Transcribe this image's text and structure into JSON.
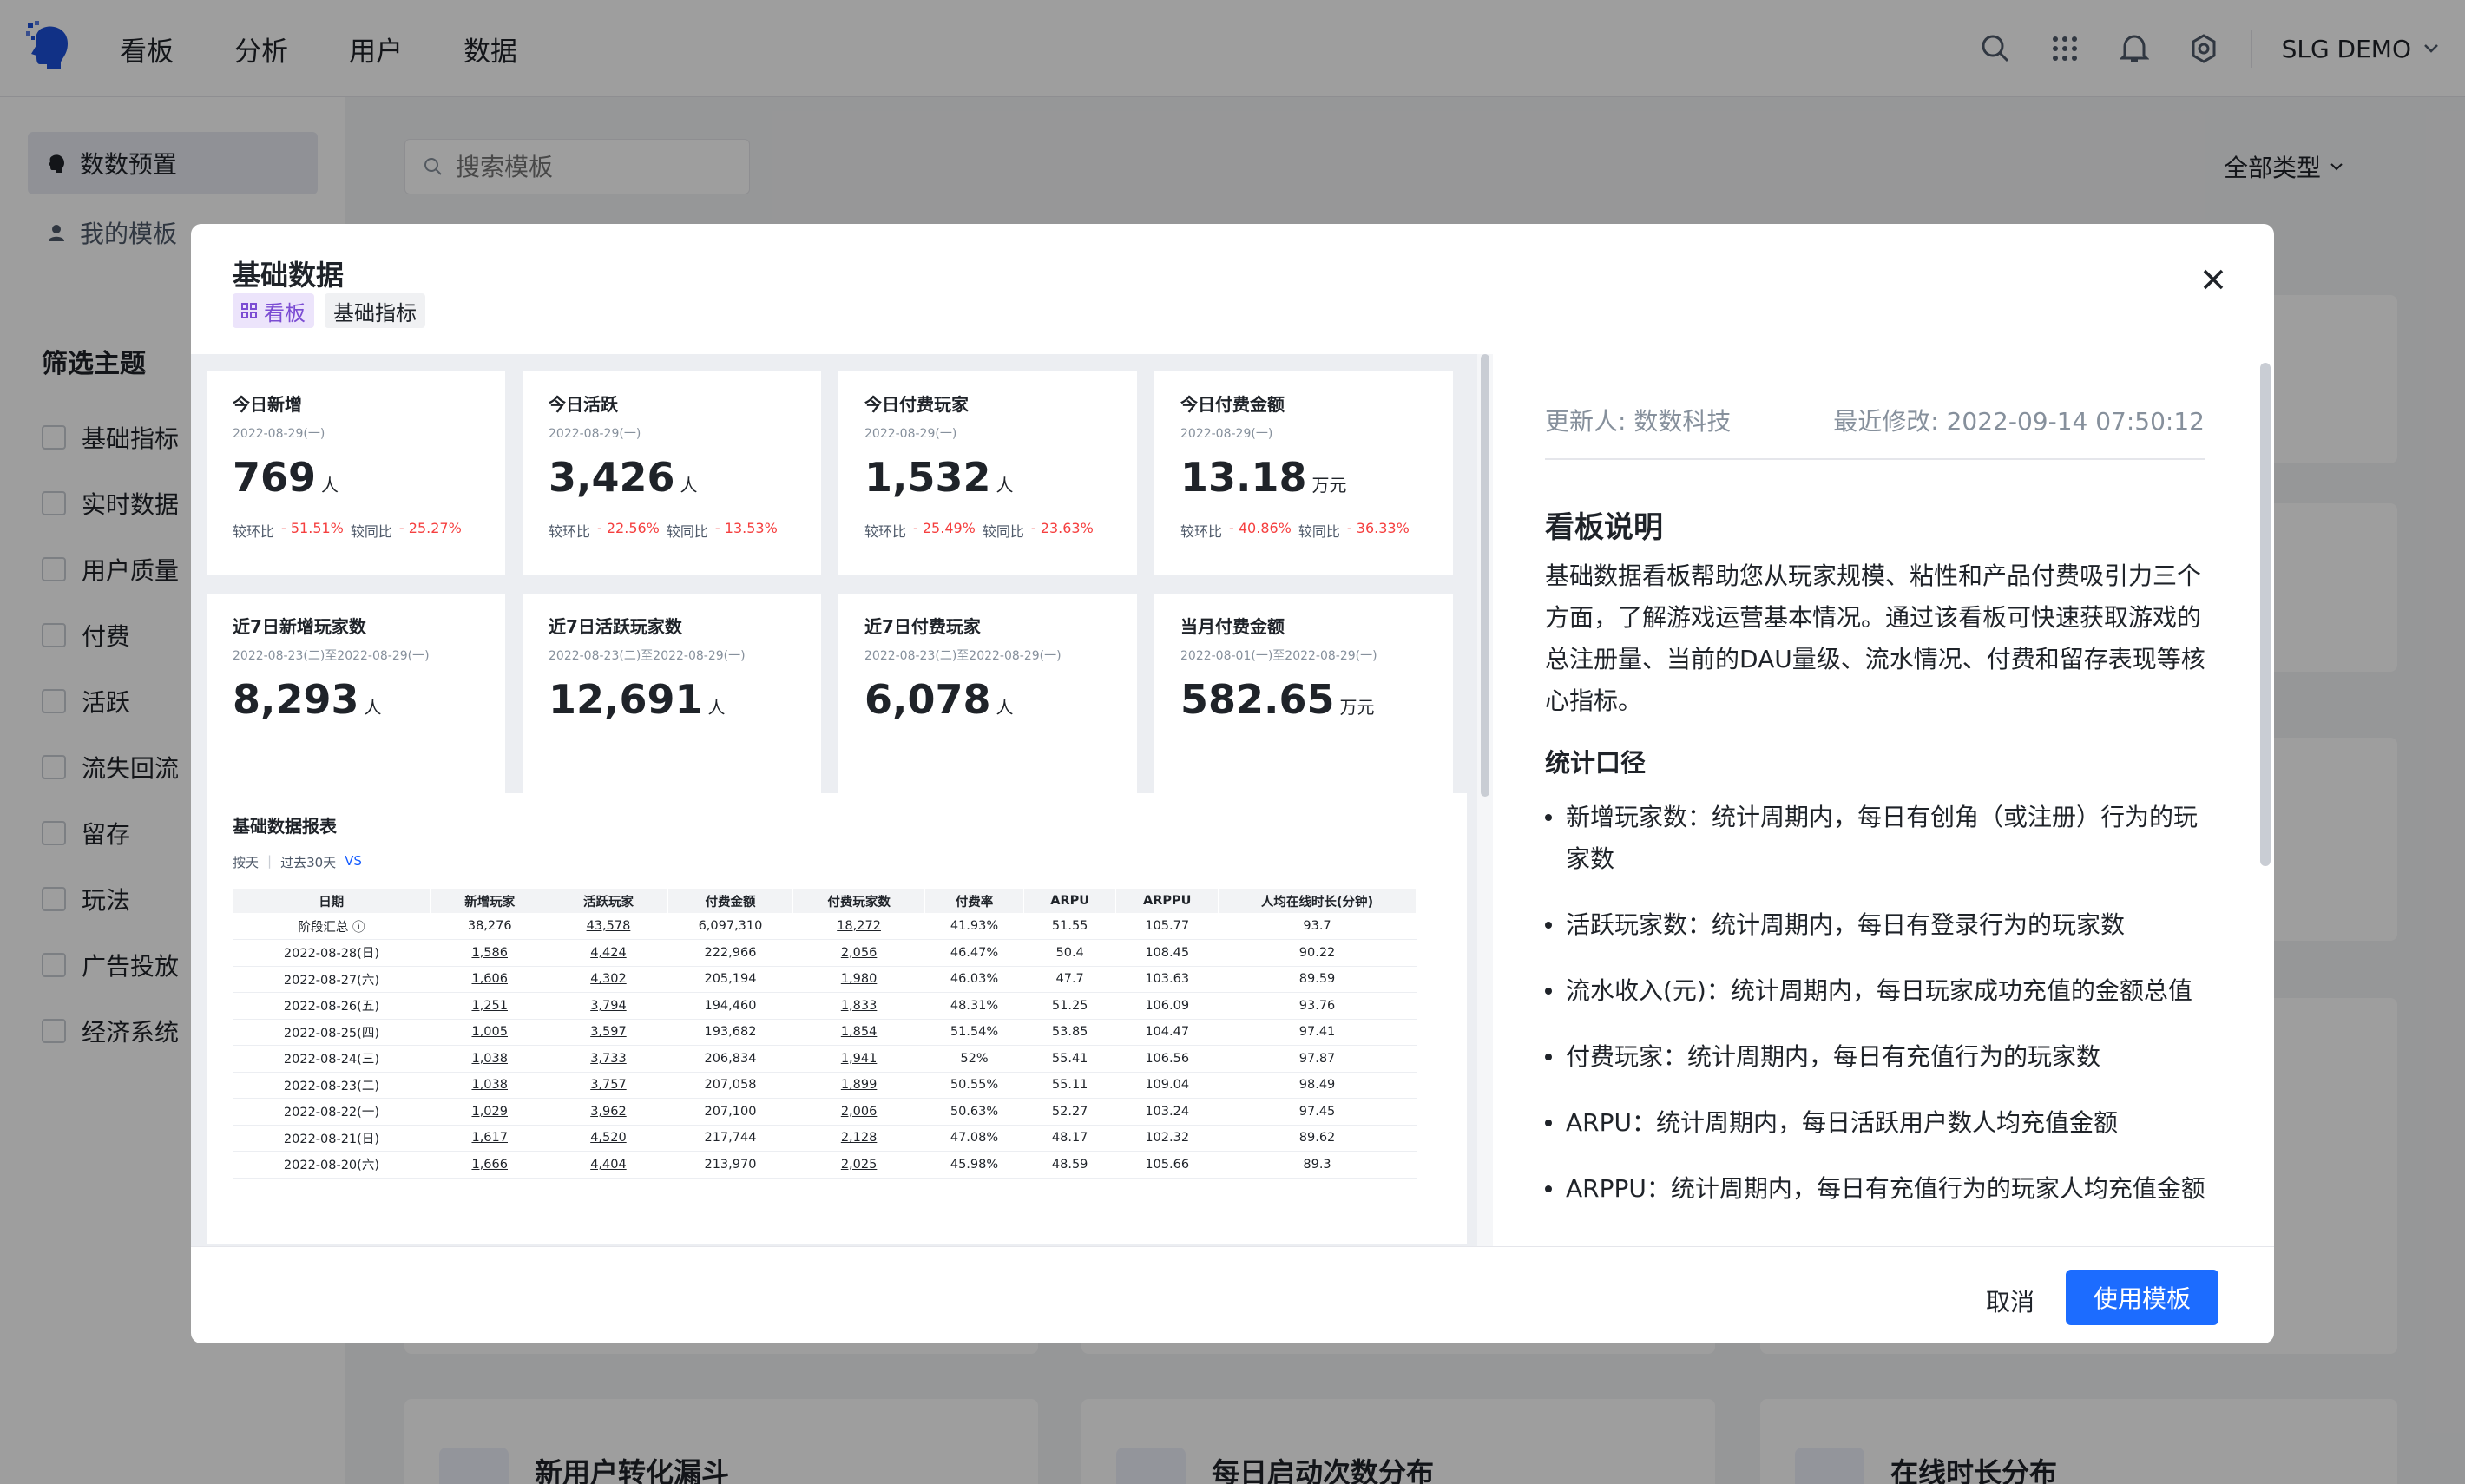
{
  "nav": {
    "items": [
      "看板",
      "分析",
      "用户",
      "数据"
    ],
    "project": "SLG DEMO"
  },
  "sidebar": {
    "items": [
      {
        "label": "数数预置"
      },
      {
        "label": "我的模板"
      }
    ],
    "filter_title": "筛选主题",
    "filters": [
      "基础指标",
      "实时数据",
      "用户质量",
      "付费",
      "活跃",
      "流失回流",
      "留存",
      "玩法",
      "广告投放",
      "经济系统"
    ]
  },
  "search": {
    "placeholder": "搜索模板"
  },
  "type_filter": "全部类型",
  "bg_cards": [
    "新用户转化漏斗",
    "每日启动次数分布",
    "在线时长分布"
  ],
  "modal": {
    "title": "基础数据",
    "tags": [
      "看板",
      "基础指标"
    ],
    "kpis": [
      {
        "label": "今日新增",
        "date": "2022-08-29(一)",
        "value": "769",
        "unit": "人",
        "c1": "较环比",
        "v1": "- 51.51%",
        "c2": "较同比",
        "v2": "- 25.27%"
      },
      {
        "label": "今日活跃",
        "date": "2022-08-29(一)",
        "value": "3,426",
        "unit": "人",
        "c1": "较环比",
        "v1": "- 22.56%",
        "c2": "较同比",
        "v2": "- 13.53%"
      },
      {
        "label": "今日付费玩家",
        "date": "2022-08-29(一)",
        "value": "1,532",
        "unit": "人",
        "c1": "较环比",
        "v1": "- 25.49%",
        "c2": "较同比",
        "v2": "- 23.63%"
      },
      {
        "label": "今日付费金额",
        "date": "2022-08-29(一)",
        "value": "13.18",
        "unit": "万元",
        "c1": "较环比",
        "v1": "- 40.86%",
        "c2": "较同比",
        "v2": "- 36.33%"
      },
      {
        "label": "近7日新增玩家数",
        "date": "2022-08-23(二)至2022-08-29(一)",
        "value": "8,293",
        "unit": "人"
      },
      {
        "label": "近7日活跃玩家数",
        "date": "2022-08-23(二)至2022-08-29(一)",
        "value": "12,691",
        "unit": "人"
      },
      {
        "label": "近7日付费玩家",
        "date": "2022-08-23(二)至2022-08-29(一)",
        "value": "6,078",
        "unit": "人"
      },
      {
        "label": "当月付费金额",
        "date": "2022-08-01(一)至2022-08-29(一)",
        "value": "582.65",
        "unit": "万元"
      }
    ],
    "report": {
      "title": "基础数据报表",
      "controls": [
        "按天",
        "过去30天",
        "VS"
      ],
      "columns": [
        "日期",
        "新增玩家",
        "活跃玩家",
        "付费金额",
        "付费玩家数",
        "付费率",
        "ARPU",
        "ARPPU",
        "人均在线时长(分钟)"
      ],
      "rows": [
        [
          "阶段汇总 ⓘ",
          "38,276",
          "43,578",
          "6,097,310",
          "18,272",
          "41.93%",
          "51.55",
          "105.77",
          "93.7"
        ],
        [
          "2022-08-28(日)",
          "1,586",
          "4,424",
          "222,966",
          "2,056",
          "46.47%",
          "50.4",
          "108.45",
          "90.22"
        ],
        [
          "2022-08-27(六)",
          "1,606",
          "4,302",
          "205,194",
          "1,980",
          "46.03%",
          "47.7",
          "103.63",
          "89.59"
        ],
        [
          "2022-08-26(五)",
          "1,251",
          "3,794",
          "194,460",
          "1,833",
          "48.31%",
          "51.25",
          "106.09",
          "93.76"
        ],
        [
          "2022-08-25(四)",
          "1,005",
          "3,597",
          "193,682",
          "1,854",
          "51.54%",
          "53.85",
          "104.47",
          "97.41"
        ],
        [
          "2022-08-24(三)",
          "1,038",
          "3,733",
          "206,834",
          "1,941",
          "52%",
          "55.41",
          "106.56",
          "97.87"
        ],
        [
          "2022-08-23(二)",
          "1,038",
          "3,757",
          "207,058",
          "1,899",
          "50.55%",
          "55.11",
          "109.04",
          "98.49"
        ],
        [
          "2022-08-22(一)",
          "1,029",
          "3,962",
          "207,100",
          "2,006",
          "50.63%",
          "52.27",
          "103.24",
          "97.45"
        ],
        [
          "2022-08-21(日)",
          "1,617",
          "4,520",
          "217,744",
          "2,128",
          "47.08%",
          "48.17",
          "102.32",
          "89.62"
        ],
        [
          "2022-08-20(六)",
          "1,666",
          "4,404",
          "213,970",
          "2,025",
          "45.98%",
          "48.59",
          "105.66",
          "89.3"
        ]
      ]
    },
    "meta": {
      "updater": "更新人: 数数科技",
      "modified": "最近修改: 2022-09-14 07:50:12"
    },
    "desc_title": "看板说明",
    "desc": "基础数据看板帮助您从玩家规模、粘性和产品付费吸引力三个方面，了解游戏运营基本情况。通过该看板可快速获取游戏的总注册量、当前的DAU量级、流水情况、付费和留存表现等核心指标。",
    "stat_title": "统计口径",
    "bullets": [
      "新增玩家数：统计周期内，每日有创角（或注册）行为的玩家数",
      "活跃玩家数：统计周期内，每日有登录行为的玩家数",
      "流水收入(元)：统计周期内，每日玩家成功充值的金额总值",
      "付费玩家：统计周期内，每日有充值行为的玩家数",
      "ARPU：统计周期内，每日活跃用户数人均充值金额",
      "ARPPU：统计周期内，每日有充值行为的玩家人均充值金额"
    ],
    "cancel": "取消",
    "use": "使用模板"
  }
}
